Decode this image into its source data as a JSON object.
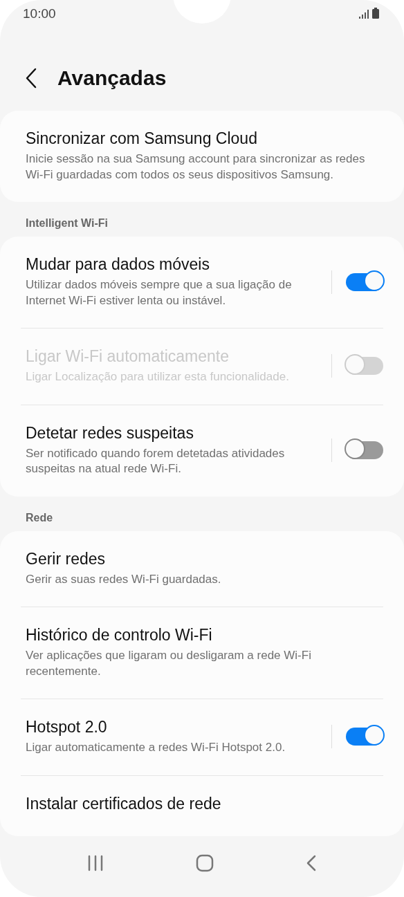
{
  "status_bar": {
    "time": "10:00"
  },
  "header": {
    "title": "Avançadas"
  },
  "sections": [
    {
      "rows": [
        {
          "kind": "plain",
          "title": "Sincronizar com Samsung Cloud",
          "subtitle": "Inicie sessão na sua Samsung account para sincronizar as redes Wi-Fi guardadas com todos os seus dispositivos Samsung.",
          "disabled": false
        }
      ]
    },
    {
      "label": "Intelligent Wi-Fi",
      "rows": [
        {
          "kind": "toggle",
          "title": "Mudar para dados móveis",
          "subtitle": "Utilizar dados móveis sempre que a sua ligação de Internet Wi-Fi estiver lenta ou instável.",
          "on": true,
          "disabled": false
        },
        {
          "kind": "toggle",
          "title": "Ligar Wi-Fi automaticamente",
          "subtitle": "Ligar Localização para utilizar esta funcionalidade.",
          "on": false,
          "disabled": true
        },
        {
          "kind": "toggle",
          "title": "Detetar redes suspeitas",
          "subtitle": "Ser notificado quando forem detetadas atividades suspeitas na atual rede Wi-Fi.",
          "on": false,
          "disabled": false
        }
      ]
    },
    {
      "label": "Rede",
      "rows": [
        {
          "kind": "plain",
          "title": "Gerir redes",
          "subtitle": "Gerir as suas redes Wi-Fi guardadas.",
          "disabled": false
        },
        {
          "kind": "plain",
          "title": "Histórico de controlo Wi-Fi",
          "subtitle": "Ver aplicações que ligaram ou desligaram a rede Wi-Fi recentemente.",
          "disabled": false
        },
        {
          "kind": "toggle",
          "title": "Hotspot 2.0",
          "subtitle": "Ligar automaticamente a redes Wi-Fi Hotspot 2.0.",
          "on": true,
          "disabled": false
        },
        {
          "kind": "plain",
          "title": "Instalar certificados de rede",
          "disabled": false
        }
      ]
    }
  ]
}
